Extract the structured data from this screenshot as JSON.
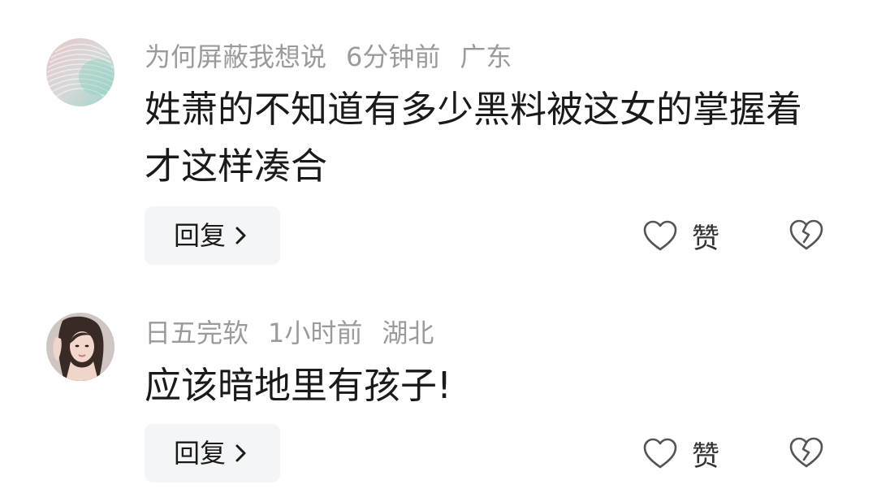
{
  "comments": [
    {
      "username": "为何屏蔽我想说",
      "time": "6分钟前",
      "location": "广东",
      "text": "姓萧的不知道有多少黑料被这女的掌握着才这样凑合",
      "reply_label": "回复",
      "like_label": "赞",
      "avatar": "abstract-striped-avatar"
    },
    {
      "username": "日五完软",
      "time": "1小时前",
      "location": "湖北",
      "text": "应该暗地里有孩子!",
      "reply_label": "回复",
      "like_label": "赞",
      "avatar": "woman-portrait-avatar"
    }
  ],
  "icons": {
    "reply_chevron": "chevron-right-icon",
    "like": "heart-outline-icon",
    "dislike": "broken-heart-icon"
  },
  "colors": {
    "meta_text": "#9b9b9b",
    "content_text": "#1a1a1a",
    "reply_bg": "#f4f5f7",
    "icon_stroke": "#555555"
  }
}
